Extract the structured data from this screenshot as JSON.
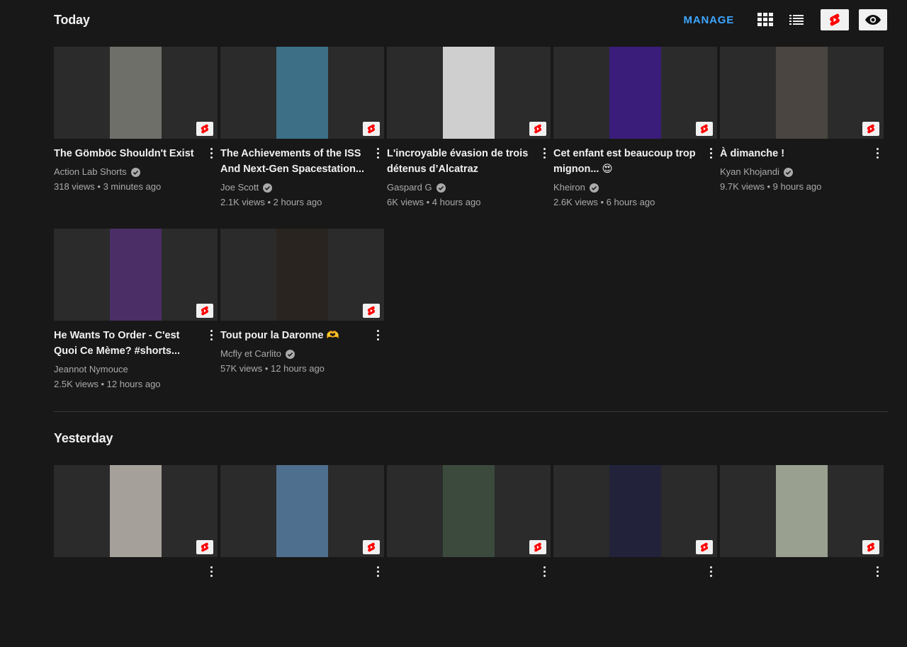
{
  "toolbar": {
    "manage_label": "MANAGE",
    "grid_icon": "grid-view-icon",
    "list_icon": "list-view-icon",
    "shorts_filter_icon": "shorts-icon",
    "visibility_icon": "eye-icon"
  },
  "colors": {
    "accent": "#3ea6ff",
    "background": "#181818",
    "shorts_red": "#ff0000"
  },
  "today": {
    "title": "Today",
    "videos": [
      {
        "title": "The Gömböc Shouldn't Exist",
        "channel": "Action Lab Shorts",
        "verified": true,
        "stats": "318 views • 3 minutes ago",
        "thumb_bg": "#6f6f6a"
      },
      {
        "title": "The Achievements of the ISS And Next-Gen Spacestation...",
        "channel": "Joe Scott",
        "verified": true,
        "stats": "2.1K views • 2 hours ago",
        "thumb_bg": "#3d6f86"
      },
      {
        "title": "L'incroyable évasion de trois détenus d’Alcatraz",
        "channel": "Gaspard G",
        "verified": true,
        "stats": "6K views • 4 hours ago",
        "thumb_bg": "#cfcfcf"
      },
      {
        "title": "Cet enfant est beaucoup trop mignon... 😍",
        "channel": "Kheiron",
        "verified": true,
        "stats": "2.6K views • 6 hours ago",
        "thumb_bg": "#3a1d7a"
      },
      {
        "title": "À dimanche !",
        "channel": "Kyan Khojandi",
        "verified": true,
        "stats": "9.7K views • 9 hours ago",
        "thumb_bg": "#4a4540"
      },
      {
        "title": "He Wants To Order - C'est Quoi Ce Mème? #shorts...",
        "channel": "Jeannot Nymouce",
        "verified": false,
        "stats": "2.5K views • 12 hours ago",
        "thumb_bg": "#4b2e66"
      },
      {
        "title": "Tout pour la Daronne 🫶",
        "channel": "Mcfly et Carlito",
        "verified": true,
        "stats": "57K views • 12 hours ago",
        "thumb_bg": "#2a2420"
      }
    ]
  },
  "yesterday": {
    "title": "Yesterday",
    "videos": [
      {
        "thumb_bg": "#a6a09b"
      },
      {
        "thumb_bg": "#4f6f8f"
      },
      {
        "thumb_bg": "#3b4a3c"
      },
      {
        "thumb_bg": "#22223a"
      },
      {
        "thumb_bg": "#9aa090"
      }
    ]
  }
}
